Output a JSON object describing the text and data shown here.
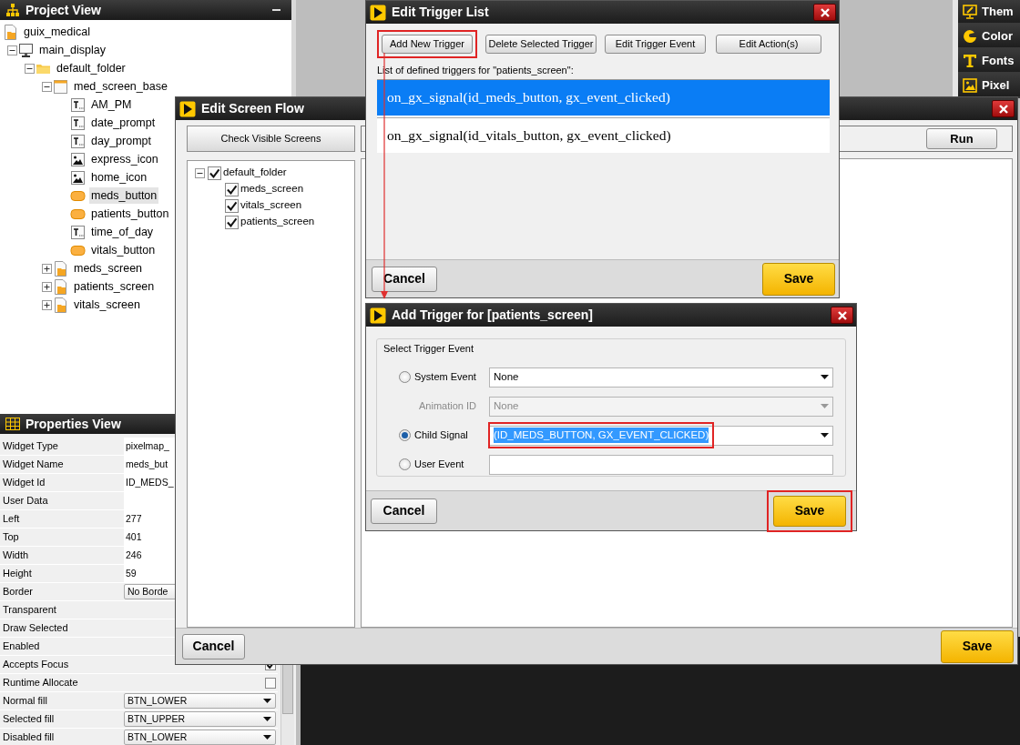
{
  "project_view": {
    "title": "Project View",
    "tree": [
      {
        "label": "guix_medical",
        "kind": "project",
        "selected": false,
        "children": [
          {
            "label": "main_display",
            "kind": "display",
            "expanded": true,
            "selected": false,
            "children": [
              {
                "label": "default_folder",
                "kind": "folder",
                "expanded": true,
                "selected": false,
                "children": [
                  {
                    "label": "med_screen_base",
                    "kind": "window",
                    "expanded": true,
                    "selected": false,
                    "children": [
                      {
                        "label": "AM_PM",
                        "kind": "text",
                        "selected": false
                      },
                      {
                        "label": "date_prompt",
                        "kind": "text",
                        "selected": false
                      },
                      {
                        "label": "day_prompt",
                        "kind": "text",
                        "selected": false
                      },
                      {
                        "label": "express_icon",
                        "kind": "image",
                        "selected": false
                      },
                      {
                        "label": "home_icon",
                        "kind": "image",
                        "selected": false
                      },
                      {
                        "label": "meds_button",
                        "kind": "button",
                        "selected": true
                      },
                      {
                        "label": "patients_button",
                        "kind": "button",
                        "selected": false
                      },
                      {
                        "label": "time_of_day",
                        "kind": "text",
                        "selected": false
                      },
                      {
                        "label": "vitals_button",
                        "kind": "button",
                        "selected": false
                      }
                    ]
                  },
                  {
                    "label": "meds_screen",
                    "kind": "screen",
                    "expanded": false,
                    "selected": false
                  },
                  {
                    "label": "patients_screen",
                    "kind": "screen",
                    "expanded": false,
                    "selected": false
                  },
                  {
                    "label": "vitals_screen",
                    "kind": "screen",
                    "expanded": false,
                    "selected": false
                  }
                ]
              }
            ]
          }
        ]
      }
    ]
  },
  "properties_view": {
    "title": "Properties View",
    "rows": [
      {
        "label": "Widget Type",
        "kind": "text",
        "value": "pixelmap_"
      },
      {
        "label": "Widget Name",
        "kind": "text",
        "value": "meds_but"
      },
      {
        "label": "Widget Id",
        "kind": "text",
        "value": "ID_MEDS_"
      },
      {
        "label": "User Data",
        "kind": "text"
      },
      {
        "label": "Left",
        "kind": "text",
        "value": "277"
      },
      {
        "label": "Top",
        "kind": "text",
        "value": "401"
      },
      {
        "label": "Width",
        "kind": "text",
        "value": "246"
      },
      {
        "label": "Height",
        "kind": "text",
        "value": "59"
      },
      {
        "label": "Border",
        "kind": "dropdown",
        "value": "No Borde"
      },
      {
        "label": "Transparent",
        "kind": "plain"
      },
      {
        "label": "Draw Selected",
        "kind": "plain"
      },
      {
        "label": "Enabled",
        "kind": "plain"
      },
      {
        "label": "Accepts Focus",
        "kind": "checkbox",
        "checked": true
      },
      {
        "label": "Runtime Allocate",
        "kind": "checkbox",
        "checked": false
      },
      {
        "label": "Normal fill",
        "kind": "dropdown",
        "value": "BTN_LOWER"
      },
      {
        "label": "Selected fill",
        "kind": "dropdown",
        "value": "BTN_UPPER"
      },
      {
        "label": "Disabled fill",
        "kind": "dropdown",
        "value": "BTN_LOWER"
      }
    ]
  },
  "resource_tabs": [
    {
      "label": "Them",
      "kind": "theme"
    },
    {
      "label": "Color",
      "kind": "color"
    },
    {
      "label": "Fonts",
      "kind": "font"
    },
    {
      "label": "Pixel",
      "kind": "pixelmap"
    }
  ],
  "screen_flow": {
    "title": "Edit Screen Flow",
    "check_button": "Check Visible Screens",
    "tree": [
      {
        "label": "default_folder",
        "checked": true,
        "expanded": true,
        "children": [
          {
            "label": "meds_screen",
            "checked": true
          },
          {
            "label": "vitals_screen",
            "checked": true
          },
          {
            "label": "patients_screen",
            "checked": true
          }
        ]
      }
    ],
    "run_button": "Run",
    "cancel_button": "Cancel",
    "save_button": "Save"
  },
  "trigger_list": {
    "title": "Edit Trigger List",
    "buttons": [
      {
        "label": "Add New Trigger",
        "highlighted": true
      },
      {
        "label": "Delete Selected Trigger",
        "highlighted": false
      },
      {
        "label": "Edit Trigger Event",
        "highlighted": false
      },
      {
        "label": "Edit Action(s)",
        "highlighted": false
      }
    ],
    "caption": "List of defined triggers for \"patients_screen\":",
    "triggers": [
      {
        "text": "on_gx_signal(id_meds_button, gx_event_clicked)",
        "selected": true
      },
      {
        "text": "on_gx_signal(id_vitals_button, gx_event_clicked)",
        "selected": false
      }
    ],
    "cancel_button": "Cancel",
    "save_button": "Save"
  },
  "add_trigger": {
    "title": "Add Trigger for [patients_screen]",
    "group": "Select Trigger Event",
    "events": [
      {
        "label": "System Event",
        "kind": "radio",
        "selected": false,
        "value": "None",
        "disabled": false,
        "highlighted": false
      },
      {
        "label": "Animation ID",
        "kind": "plain",
        "value": "None",
        "disabled": true,
        "highlighted": false
      },
      {
        "label": "Child Signal",
        "kind": "radio",
        "selected": true,
        "value": "(ID_MEDS_BUTTON, GX_EVENT_CLICKED)",
        "disabled": false,
        "highlighted": true
      },
      {
        "label": "User Event",
        "kind": "radio",
        "selected": false,
        "disabled": false,
        "highlighted": false
      }
    ],
    "cancel_button": "Cancel",
    "save_button": "Save",
    "save_highlighted": true
  }
}
